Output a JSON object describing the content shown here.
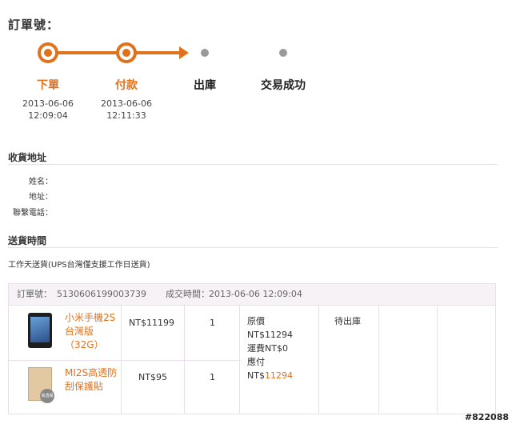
{
  "page": {
    "order_number_heading": "訂單號："
  },
  "progress": {
    "accent_color": "#e0721c",
    "steps": [
      {
        "label": "下單",
        "date": "2013-06-06",
        "time": "12:09:04",
        "done": true
      },
      {
        "label": "付款",
        "date": "2013-06-06",
        "time": "12:11:33",
        "done": true
      },
      {
        "label": "出庫",
        "done": false
      },
      {
        "label": "交易成功",
        "done": false
      }
    ]
  },
  "shipping_address": {
    "title": "收貨地址",
    "fields": [
      {
        "label": "姓名："
      },
      {
        "label": "地址："
      },
      {
        "label": "聯繫電話："
      }
    ]
  },
  "delivery": {
    "title": "送貨時間",
    "value": "工作天送貨(UPS台灣僅支援工作日送貨)"
  },
  "order": {
    "number_label": "訂單號：",
    "number": "5130606199003739",
    "deal_time_label": "成交時間：",
    "deal_time": "2013-06-06 12:09:04",
    "items": [
      {
        "name_line1": "小米手機2S",
        "name_line2": "台灣版",
        "name_line3": "（32G）",
        "price": "NT$11199",
        "qty": "1",
        "icon": "phone-icon"
      },
      {
        "name_line1": "MI2S高透防",
        "name_line2": "刮保護貼",
        "price": "NT$95",
        "qty": "1",
        "icon": "screen-protector-icon",
        "badge": "高透保護"
      }
    ],
    "summary": {
      "original_label": "原價",
      "original_value": "NT$11294",
      "shipping_label": "運費NT$0",
      "payable_label": "應付",
      "payable_prefix": "NT$",
      "payable_value": "11294"
    },
    "status": "待出庫"
  },
  "watermark": "#822088"
}
